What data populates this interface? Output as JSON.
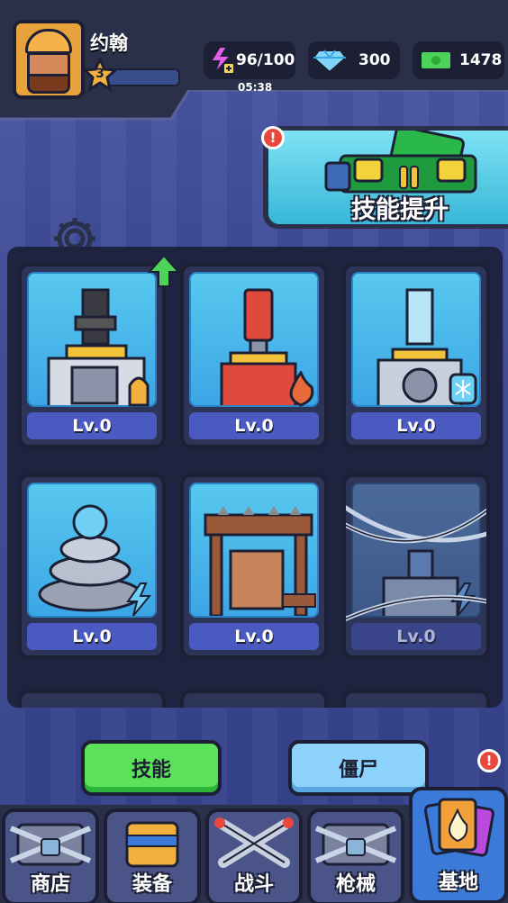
{
  "player": {
    "name": "约翰",
    "level": "3"
  },
  "resources": {
    "energy": {
      "icon": "energy-bolt-icon",
      "value": "96/100",
      "timer": "05:38"
    },
    "gems": {
      "icon": "diamond-icon",
      "value": "300"
    },
    "cash": {
      "icon": "cash-icon",
      "value": "1478"
    }
  },
  "banner": {
    "label": "技能提升",
    "alert": "!"
  },
  "skills": [
    {
      "level": "Lv.0",
      "badge": "bullet-icon",
      "locked": false,
      "upgrade": true
    },
    {
      "level": "Lv.0",
      "badge": "fire-icon",
      "locked": false,
      "upgrade": false
    },
    {
      "level": "Lv.0",
      "badge": "snowflake-icon",
      "locked": false,
      "upgrade": false
    },
    {
      "level": "Lv.0",
      "badge": "lightning-icon",
      "locked": false,
      "upgrade": false
    },
    {
      "level": "Lv.0",
      "badge": "spike-icon",
      "locked": false,
      "upgrade": false
    },
    {
      "level": "Lv.0",
      "badge": "lightning-icon",
      "locked": true,
      "upgrade": false
    }
  ],
  "tabs": {
    "skill": "技能",
    "zombie": "僵尸"
  },
  "nav": {
    "shop": "商店",
    "equip": "装备",
    "battle": "战斗",
    "guns": "枪械",
    "base": "基地",
    "base_alert": "!"
  },
  "colors": {
    "accent_green": "#5ce25a",
    "accent_blue": "#8cd2fa",
    "alert_red": "#e8483e"
  }
}
